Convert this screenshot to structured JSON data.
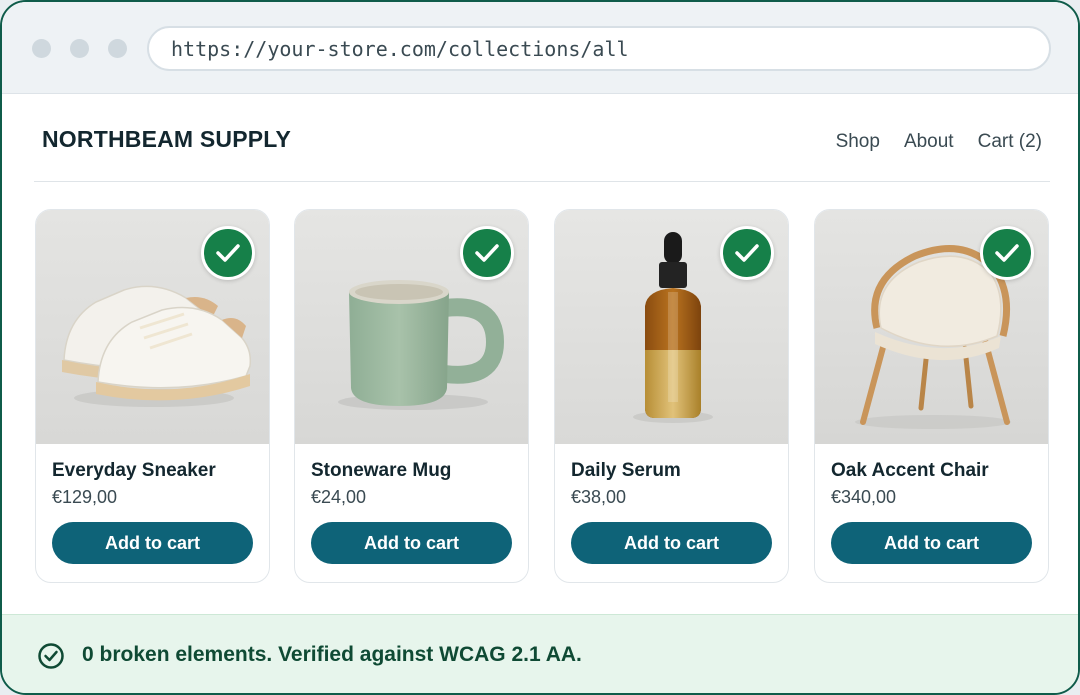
{
  "browser": {
    "url": "https://your-store.com/collections/all"
  },
  "header": {
    "brand": "NORTHBEAM SUPPLY",
    "nav": {
      "shop": "Shop",
      "about": "About",
      "cart": "Cart (2)"
    }
  },
  "products": [
    {
      "title": "Everyday Sneaker",
      "price": "€129,00",
      "button": "Add to cart",
      "image": "sneaker-image",
      "verified_icon": "check-icon"
    },
    {
      "title": "Stoneware Mug",
      "price": "€24,00",
      "button": "Add to cart",
      "image": "mug-image",
      "verified_icon": "check-icon"
    },
    {
      "title": "Daily Serum",
      "price": "€38,00",
      "button": "Add to cart",
      "image": "serum-bottle-image",
      "verified_icon": "check-icon"
    },
    {
      "title": "Oak Accent Chair",
      "price": "€340,00",
      "button": "Add to cart",
      "image": "chair-image",
      "verified_icon": "check-icon"
    }
  ],
  "status": {
    "message": "0 broken elements. Verified against WCAG 2.1 AA.",
    "icon": "check-circle-icon"
  },
  "colors": {
    "accent_button": "#0e6378",
    "verified_green": "#168049",
    "status_bg": "#e7f5ec",
    "status_text": "#0f4a34"
  }
}
